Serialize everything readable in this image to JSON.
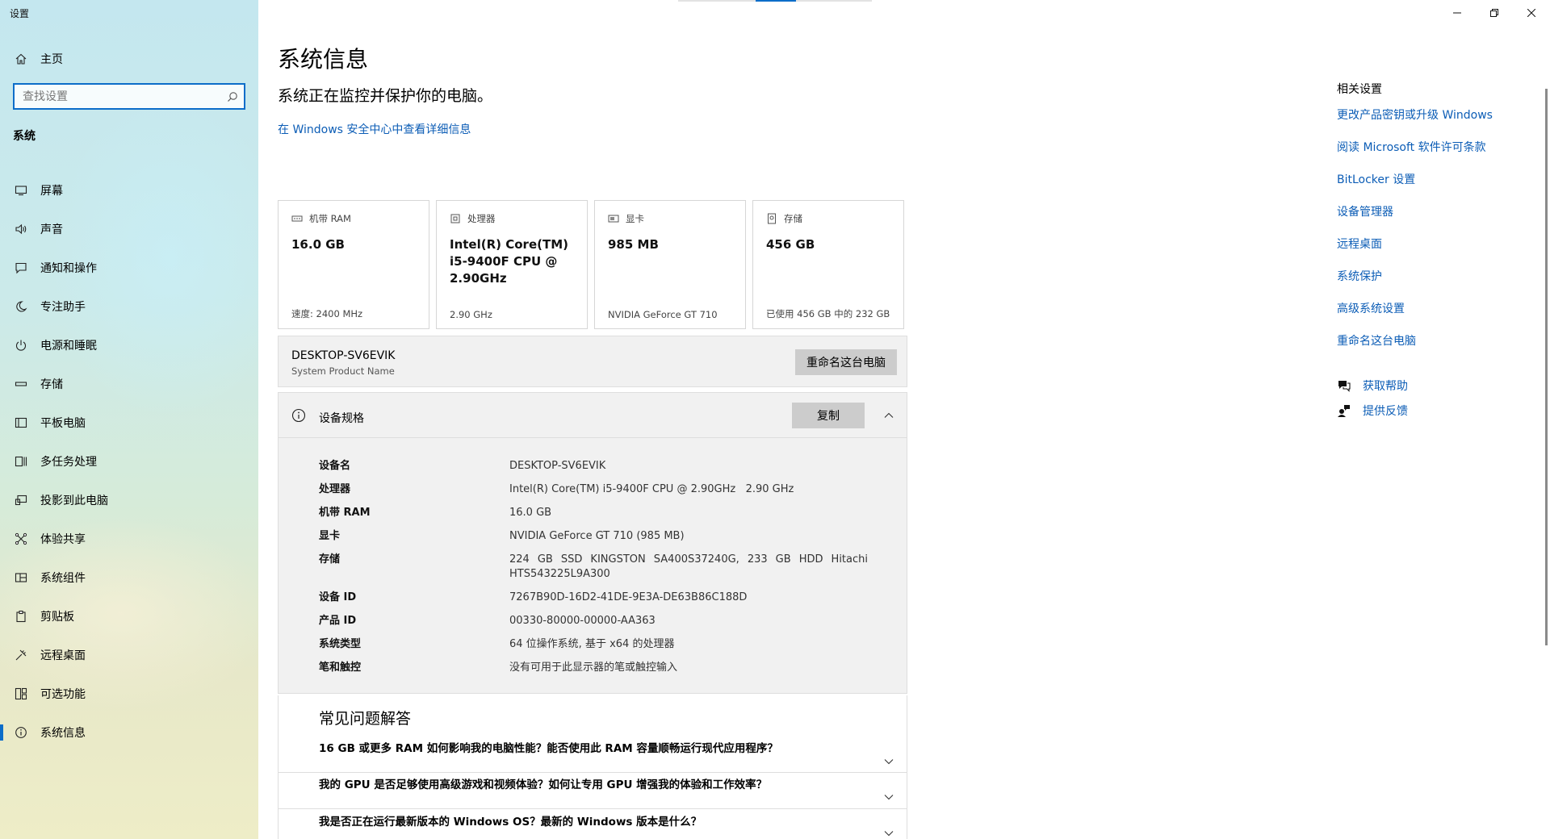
{
  "window": {
    "title": "设置"
  },
  "sidebar": {
    "home_label": "主页",
    "search_placeholder": "查找设置",
    "section": "系统",
    "items": [
      {
        "label": "屏幕",
        "icon": "monitor-icon"
      },
      {
        "label": "声音",
        "icon": "speaker-icon"
      },
      {
        "label": "通知和操作",
        "icon": "notification-icon"
      },
      {
        "label": "专注助手",
        "icon": "moon-icon"
      },
      {
        "label": "电源和睡眠",
        "icon": "power-icon"
      },
      {
        "label": "存储",
        "icon": "storage-icon"
      },
      {
        "label": "平板电脑",
        "icon": "tablet-icon"
      },
      {
        "label": "多任务处理",
        "icon": "multitask-icon"
      },
      {
        "label": "投影到此电脑",
        "icon": "project-icon"
      },
      {
        "label": "体验共享",
        "icon": "share-icon"
      },
      {
        "label": "系统组件",
        "icon": "components-icon"
      },
      {
        "label": "剪贴板",
        "icon": "clipboard-icon"
      },
      {
        "label": "远程桌面",
        "icon": "remote-icon"
      },
      {
        "label": "可选功能",
        "icon": "features-icon"
      },
      {
        "label": "系统信息",
        "icon": "info-icon",
        "active": true
      }
    ]
  },
  "main": {
    "title": "系统信息",
    "security_status": "系统正在监控并保护你的电脑。",
    "security_link": "在 Windows 安全中心中查看详细信息",
    "cards": [
      {
        "label": "机带 RAM",
        "value": "16.0 GB",
        "sub": "速度: 2400 MHz",
        "icon": "ram-icon"
      },
      {
        "label": "处理器",
        "value": "Intel(R) Core(TM) i5-9400F CPU @ 2.90GHz",
        "sub": "2.90 GHz",
        "icon": "cpu-icon"
      },
      {
        "label": "显卡",
        "value": "985 MB",
        "sub": "NVIDIA GeForce GT 710",
        "icon": "gpu-icon"
      },
      {
        "label": "存储",
        "value": "456 GB",
        "sub": "已使用 456 GB 中的 232 GB",
        "icon": "storage-icon"
      }
    ],
    "pc": {
      "name": "DESKTOP-SV6EVIK",
      "model": "System Product Name",
      "rename_button": "重命名这台电脑"
    },
    "specs": {
      "title": "设备规格",
      "copy_button": "复制",
      "rows": [
        {
          "key": "设备名",
          "value": "DESKTOP-SV6EVIK"
        },
        {
          "key": "处理器",
          "value": "Intel(R) Core(TM) i5-9400F CPU @ 2.90GHz   2.90 GHz"
        },
        {
          "key": "机带 RAM",
          "value": "16.0 GB"
        },
        {
          "key": "显卡",
          "value": "NVIDIA GeForce GT 710 (985 MB)"
        },
        {
          "key": "存储",
          "value": "224 GB SSD KINGSTON SA400S37240G, 233 GB HDD Hitachi HTS543225L9A300"
        },
        {
          "key": "设备 ID",
          "value": "7267B90D-16D2-41DE-9E3A-DE63B86C188D"
        },
        {
          "key": "产品 ID",
          "value": "00330-80000-00000-AA363"
        },
        {
          "key": "系统类型",
          "value": "64 位操作系统, 基于 x64 的处理器"
        },
        {
          "key": "笔和触控",
          "value": "没有可用于此显示器的笔或触控输入"
        }
      ]
    },
    "faq": {
      "title": "常见问题解答",
      "items": [
        "16 GB 或更多 RAM 如何影响我的电脑性能？能否使用此 RAM 容量顺畅运行现代应用程序？",
        "我的 GPU 是否足够使用高级游戏和视频体验？如何让专用 GPU 增强我的体验和工作效率？",
        "我是否正在运行最新版本的 Windows OS？最新的 Windows 版本是什么？"
      ]
    }
  },
  "related": {
    "title": "相关设置",
    "links": [
      "更改产品密钥或升级 Windows",
      "阅读 Microsoft 软件许可条款",
      "BitLocker 设置",
      "设备管理器",
      "远程桌面",
      "系统保护",
      "高级系统设置",
      "重命名这台电脑"
    ],
    "help": [
      {
        "label": "获取帮助",
        "icon": "help-chat-icon"
      },
      {
        "label": "提供反馈",
        "icon": "feedback-icon"
      }
    ]
  },
  "colors": {
    "accent": "#0c6dc9",
    "link": "#0c5db6"
  }
}
